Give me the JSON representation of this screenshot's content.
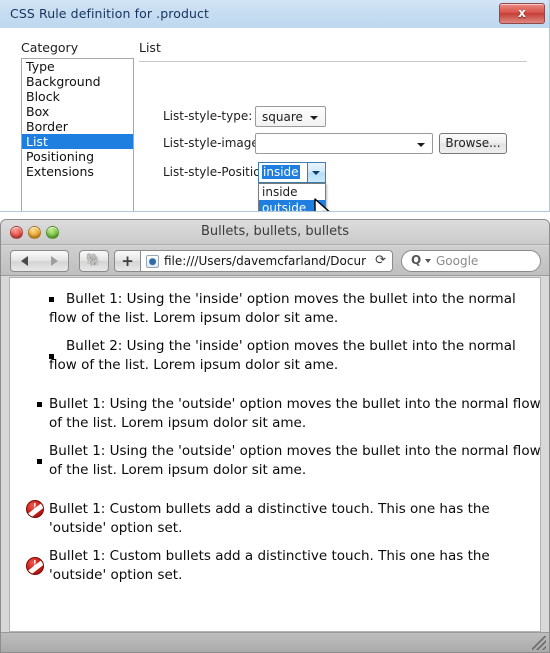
{
  "dialog": {
    "title": "CSS Rule definition for .product",
    "close_label": "x",
    "category_label": "Category",
    "categories": [
      {
        "label": "Type",
        "selected": false
      },
      {
        "label": "Background",
        "selected": false
      },
      {
        "label": "Block",
        "selected": false
      },
      {
        "label": "Box",
        "selected": false
      },
      {
        "label": "Border",
        "selected": false
      },
      {
        "label": "List",
        "selected": true
      },
      {
        "label": "Positioning",
        "selected": false
      },
      {
        "label": "Extensions",
        "selected": false
      }
    ],
    "pane_title": "List",
    "fields": {
      "list_style_type": {
        "label": "List-style-type:",
        "value": "square"
      },
      "list_style_image": {
        "label": "List-style-image:",
        "value": "",
        "browse_label": "Browse..."
      },
      "list_style_position": {
        "label": "List-style-Position:",
        "value": "inside",
        "options": [
          {
            "label": "inside",
            "highlighted": false
          },
          {
            "label": "outside",
            "highlighted": true
          }
        ]
      }
    },
    "accent_color": "#1e7fe0",
    "titlebar_color": "#c6dcf0",
    "close_color": "#d9534a"
  },
  "browser": {
    "title": "Bullets, bullets, bullets",
    "traffic_lights": [
      {
        "name": "close",
        "color": "#e0453c"
      },
      {
        "name": "minimize",
        "color": "#e39a1c"
      },
      {
        "name": "zoom",
        "color": "#66b933"
      }
    ],
    "toolbar": {
      "back_label": "◀",
      "forward_label": "▶",
      "evernote_label": "🐘",
      "add_label": "+",
      "url": "file:///Users/davemcfarland/Documen",
      "reload_label": "⟳",
      "search_glyph": "Q",
      "search_placeholder": "Google"
    }
  },
  "page": {
    "bullets": [
      {
        "style": "inside",
        "text": "Bullet 1: Using the 'inside' option moves the bullet into the normal flow of the list. Lorem ipsum dolor sit ame."
      },
      {
        "style": "inside",
        "text": "Bullet 2: Using the 'inside' option moves the bullet into the normal flow of the list. Lorem ipsum dolor sit ame."
      },
      {
        "style": "outside",
        "text": "Bullet 1: Using the 'outside' option moves the bullet into the normal flow of the list. Lorem ipsum dolor sit ame."
      },
      {
        "style": "outside",
        "text": "Bullet 1: Using the 'outside' option moves the bullet into the normal flow of the list. Lorem ipsum dolor sit ame."
      },
      {
        "style": "custom",
        "text": "Bullet 1: Custom bullets add a distinctive touch. This one has the 'outside' option set."
      },
      {
        "style": "custom",
        "text": "Bullet 1: Custom bullets add a distinctive touch. This one has the 'outside' option set."
      }
    ]
  }
}
